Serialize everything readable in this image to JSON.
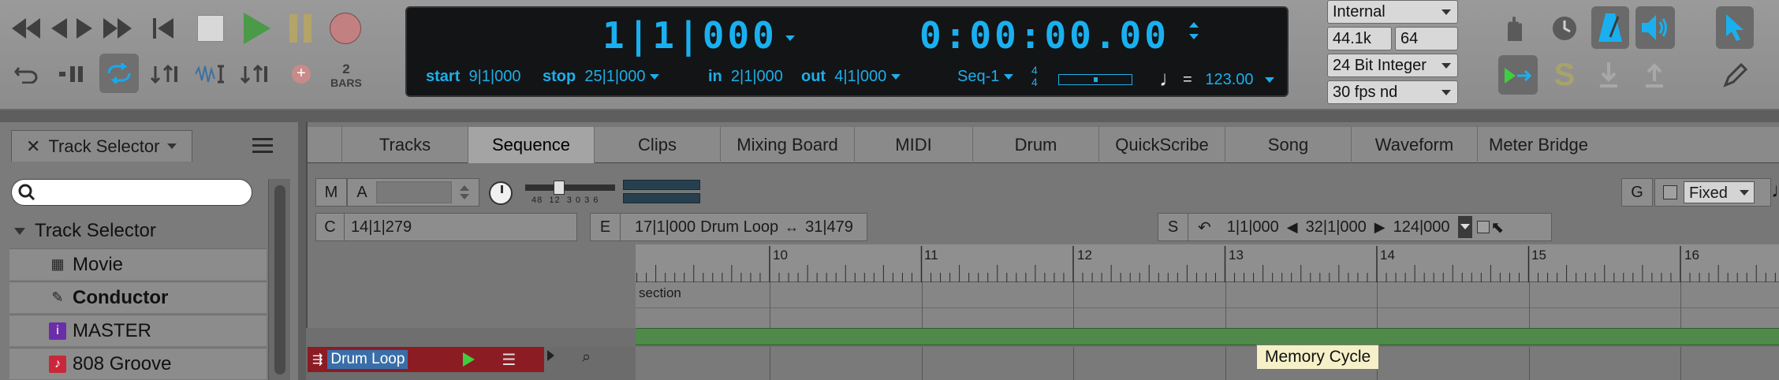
{
  "transport": {
    "icons": [
      "rewind-to-start-icon",
      "rewind-icon",
      "play-backward-icon",
      "fast-forward-icon",
      "return-to-zero-icon",
      "stop-icon",
      "play-icon",
      "pause-icon",
      "record-icon"
    ]
  },
  "toolbar2": {
    "bars_number": "2",
    "bars_label": "BARS"
  },
  "counter": {
    "main_position": "1|1|000",
    "real_time": "0:00:00.00",
    "start_label": "start",
    "start_value": "9|1|000",
    "stop_label": "stop",
    "stop_value": "25|1|000",
    "in_label": "in",
    "in_value": "2|1|000",
    "out_label": "out",
    "out_value": "4|1|000",
    "sequence": "Seq-1",
    "meter_top": "4",
    "meter_bottom": "4",
    "tempo_eq": "=",
    "tempo": "123.00"
  },
  "settings": {
    "sync": "Internal",
    "sample_rate": "44.1k",
    "buffer": "64",
    "bit_depth": "24 Bit Integer",
    "frame_rate": "30 fps nd"
  },
  "track_selector": {
    "tab_label": "Track Selector",
    "group_label": "Track Selector",
    "items": [
      {
        "label": "Movie",
        "icon": "movie-icon",
        "color": "#8c8c8c"
      },
      {
        "label": "Conductor",
        "icon": "conductor-icon",
        "color": "#8c8c8c"
      },
      {
        "label": "MASTER",
        "icon": "master-icon",
        "color": "#6a2ea8"
      },
      {
        "label": "808 Groove",
        "icon": "midi-track-icon",
        "color": "#c8283a"
      }
    ]
  },
  "tabs": [
    "Tracks",
    "Sequence",
    "Clips",
    "Mixing Board",
    "MIDI",
    "Drum",
    "QuickScribe",
    "Song",
    "Waveform",
    "Meter Bridge"
  ],
  "active_tab": "Sequence",
  "sequence": {
    "m_label": "M",
    "a_label": "A",
    "fader_ticks": [
      "48",
      "12",
      "3",
      "0",
      "3",
      "6"
    ],
    "c_label": "C",
    "c_value": "14|1|279",
    "e_label": "E",
    "e_start": "17|1|000",
    "e_name": "Drum Loop",
    "e_length": "31|479",
    "s_label": "S",
    "s_start": "1|1|000",
    "s_end": "32|1|000",
    "s_length": "124|000",
    "g_label": "G",
    "grid_mode": "Fixed"
  },
  "ruler": {
    "bars": [
      "10",
      "11",
      "12",
      "13",
      "14",
      "15",
      "16"
    ]
  },
  "section_label": "section",
  "drum_track": {
    "name": "Drum Loop"
  },
  "tooltip": "Memory Cycle"
}
